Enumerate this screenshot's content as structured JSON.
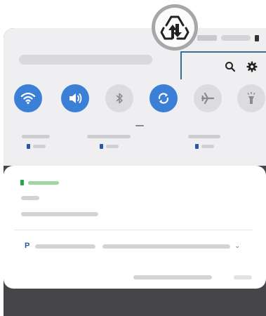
{
  "screen": {
    "date_time": "",
    "quick_settings": [
      {
        "name": "wifi",
        "icon": "wifi-icon",
        "state": "on"
      },
      {
        "name": "sound",
        "icon": "speaker-icon",
        "state": "on"
      },
      {
        "name": "bluetooth",
        "icon": "bluetooth-icon",
        "state": "off"
      },
      {
        "name": "auto-rotate",
        "icon": "rotate-icon",
        "state": "on"
      },
      {
        "name": "airplane-mode",
        "icon": "airplane-icon",
        "state": "off"
      },
      {
        "name": "flashlight",
        "icon": "flashlight-icon",
        "state": "off"
      }
    ],
    "top_icons": [
      "search-icon",
      "gear-icon"
    ],
    "callout_icon": "data-saver-icon",
    "media": {
      "prefix": "P"
    }
  },
  "colors": {
    "accent": "#3b7fd6",
    "highlight_frame": "#3a6e91",
    "notification_app": "#2aa44a"
  }
}
